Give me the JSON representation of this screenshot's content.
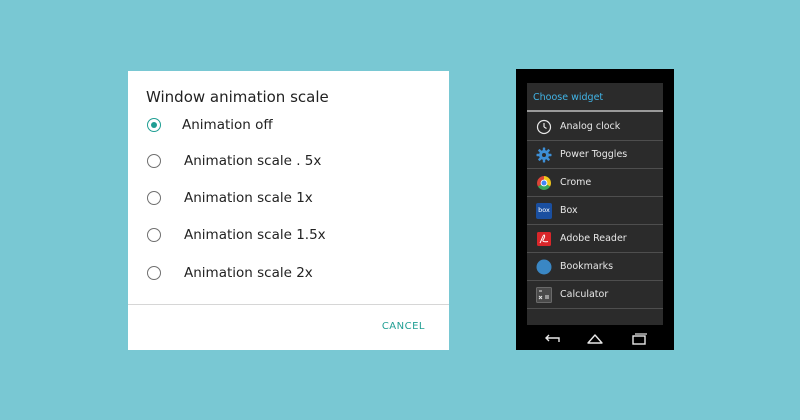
{
  "dialog": {
    "title": "Window animation scale",
    "options": [
      {
        "label": "Animation off",
        "selected": true
      },
      {
        "label": "Animation scale . 5x",
        "selected": false
      },
      {
        "label": "Animation scale 1x",
        "selected": false
      },
      {
        "label": "Animation scale 1.5x",
        "selected": false
      },
      {
        "label": "Animation scale 2x",
        "selected": false
      }
    ],
    "cancel_label": "CANCEL",
    "accent_color": "#1f9e93"
  },
  "widget_picker": {
    "title": "Choose widget",
    "items": [
      {
        "label": "Analog clock",
        "icon": "analog-clock-icon"
      },
      {
        "label": "Power Toggles",
        "icon": "gear-icon"
      },
      {
        "label": "Crome",
        "icon": "chrome-icon"
      },
      {
        "label": "Box",
        "icon": "box-icon",
        "icon_text": "box"
      },
      {
        "label": "Adobe Reader",
        "icon": "adobe-reader-icon"
      },
      {
        "label": "Bookmarks",
        "icon": "bookmarks-icon"
      },
      {
        "label": "Calculator",
        "icon": "calculator-icon"
      }
    ],
    "nav": [
      "back-icon",
      "home-icon",
      "recents-icon"
    ],
    "title_color": "#41b4e6"
  }
}
